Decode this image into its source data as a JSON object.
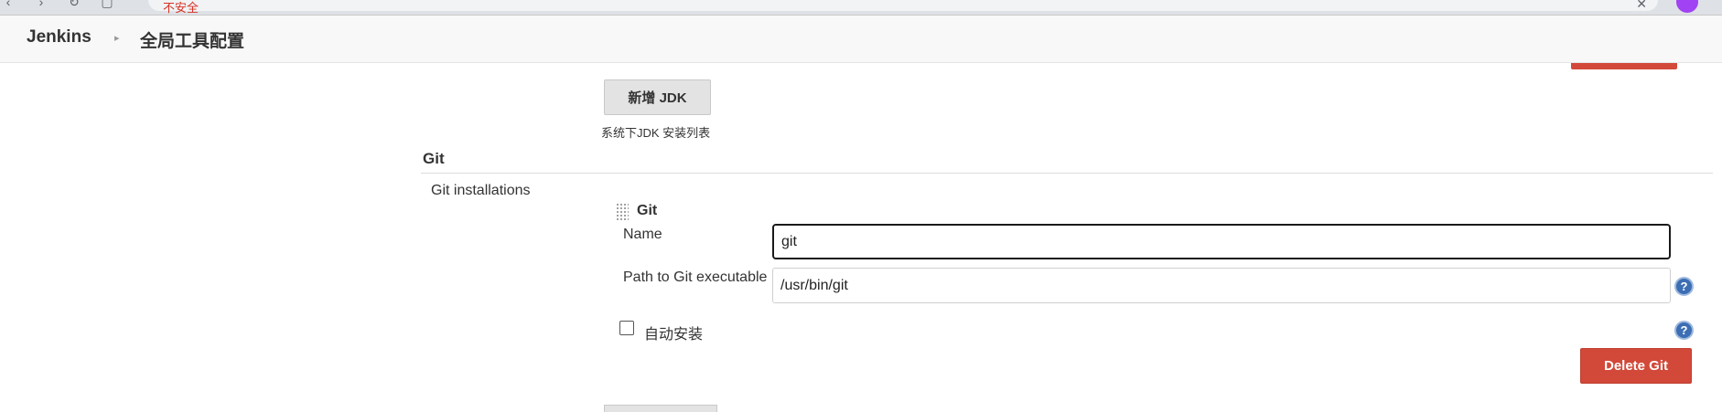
{
  "browser": {
    "nav_icons": [
      "back-icon",
      "forward-icon",
      "reload-icon",
      "site-info-icon"
    ],
    "address_warning": "不安全",
    "close_glyph": "✕"
  },
  "breadcrumb": {
    "home": "Jenkins",
    "separator": "▸",
    "page": "全局工具配置"
  },
  "jdk": {
    "add_button_label": "新增 JDK",
    "description": "系统下JDK 安装列表"
  },
  "git": {
    "section_title": "Git",
    "installations_label": "Git installations",
    "block_title": "Git",
    "name_label": "Name",
    "name_value": "git",
    "path_label": "Path to Git executable",
    "path_value": "/usr/bin/git",
    "auto_install_label": "自动安装",
    "auto_install_checked": false,
    "delete_button_label": "Delete Git",
    "help_glyph": "?"
  },
  "colors": {
    "danger": "#d24939",
    "help": "#3c6eb4",
    "header_bg": "#f8f8f8"
  }
}
